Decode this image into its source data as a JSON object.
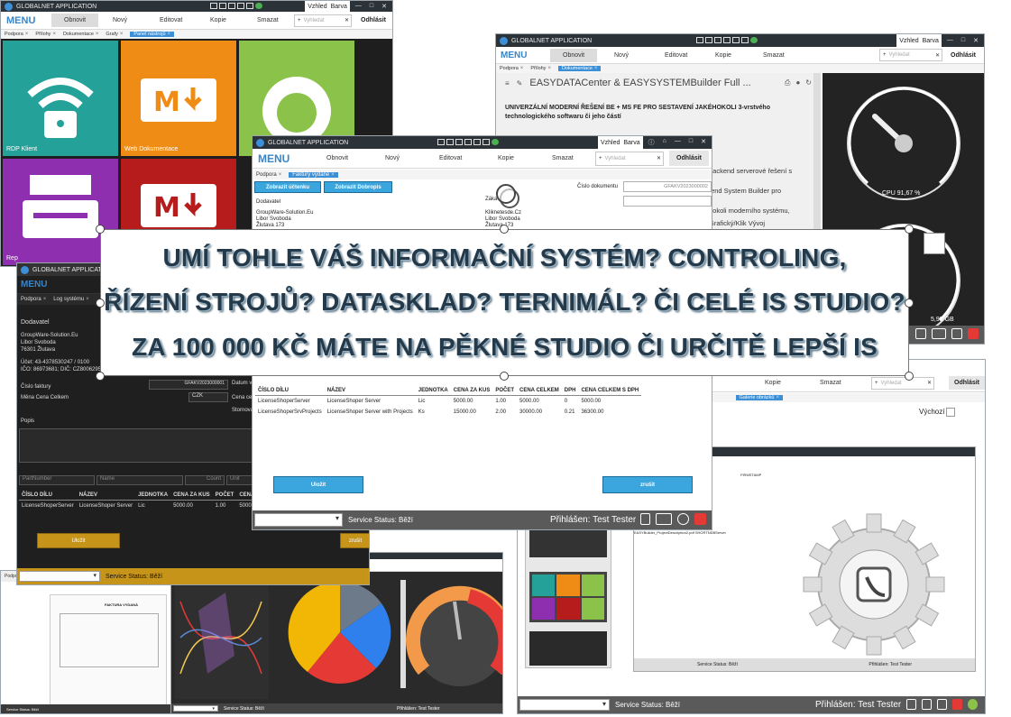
{
  "app_title": "GLOBALNET APPLICATION",
  "menu_label": "MENU",
  "menu_items": {
    "refresh": "Obnovit",
    "new": "Nový",
    "edit": "Editovat",
    "copy": "Kopie",
    "delete": "Smazat"
  },
  "search_placeholder": "Vyhledat",
  "logout": "Odhlásit",
  "view_label": "Vzhled",
  "color_label": "Barva",
  "win1": {
    "tabs": [
      "Podpora",
      "Přílohy",
      "Dokumentace",
      "Grafy",
      "Panel nástrojů"
    ],
    "tiles": [
      "RDP Klient",
      "Web Dokumentace"
    ],
    "tile_partial": "Rep"
  },
  "win2": {
    "tabs": [
      "Podpora",
      "Přílohy",
      "Dokumentace"
    ],
    "doc_title": "EASYDATACenter & EASYSYSTEMBuilder Full ...",
    "doc_heading": "UNIVERZÁLNÍ MODERNÍ ŘEŠENÍ BE + MS FE PRO SESTAVENÍ JAKÉHOKOLI 3-vrstvého technologického softwaru či jeho částí",
    "doc_lines": [
      "backend serverové řešení s",
      "tend System Builder pro",
      "hokoli moderního systému,",
      "Grafický/Klik Vývoj"
    ],
    "cpu_label": "CPU 91,67 %",
    "mem_label": "5,95 GB"
  },
  "win3": {
    "tabs": [
      "Podpora",
      "Faktury vydané"
    ],
    "btn_invoice": "Zobrazit účtenku",
    "btn_delivery": "Zobrazit Dobropis",
    "doc_number_label": "Číslo dokumentu",
    "doc_number": "GFAKV2023000002",
    "supplier_label": "Dodavatel",
    "supplier_lines": [
      "GroupWare-Solution.Eu",
      "Libor Svoboda",
      "Žlutava 173"
    ],
    "customer_label": "Záka",
    "customer_lines": [
      "Kliknetesde.Cz",
      "Libor Svoboda",
      "Žlutava 173"
    ],
    "columns": [
      "ČÍSLO DÍLU",
      "NÁZEV",
      "JEDNOTKA",
      "CENA ZA KUS",
      "POČET",
      "CENA CELKEM",
      "DPH",
      "CENA CELKEM S DPH"
    ],
    "rows": [
      [
        "LicenseShoperServer",
        "LicenseShoper Server",
        "Lic",
        "5000.00",
        "1.00",
        "5000.00",
        "0",
        "5000.00"
      ],
      [
        "LicenseShoperSrvProjects",
        "LicenseShoper Server with Projects",
        "Ks",
        "15000.00",
        "2.00",
        "30000.00",
        "0.21",
        "36300.00"
      ]
    ],
    "save": "Uložit",
    "cancel": "zrušit",
    "service_status": "Service Status: Běží",
    "signed_in": "Přihlášen: Test Tester"
  },
  "win4": {
    "tabs": [
      "Podpora",
      "Log systému"
    ],
    "supplier_label": "Dodavatel",
    "supplier_lines": [
      "GroupWare-Solution.Eu",
      "Libor Svoboda",
      "76301 Žlutava"
    ],
    "account": "Účet: 43-4378530247 / 0100",
    "ico": "IČO: 86973681; DIČ: CZ8006295135",
    "invoice_no_label": "Číslo faktury",
    "invoice_no": "GFAKV2023000001",
    "date_label": "Datum vy",
    "currency_label": "Měna Cena Celkem",
    "currency": "CZK",
    "total_label": "Cena cel",
    "storno_label": "Stornová",
    "note_label": "Popis",
    "filter_part": "PartNumber",
    "filter_name": "Name",
    "filter_count": "Count",
    "filter_unit": "Unit",
    "columns": [
      "ČÍSLO DÍLU",
      "NÁZEV",
      "JEDNOTKA",
      "CENA ZA KUS",
      "POČET",
      "CENA CELKEM"
    ],
    "row": [
      "LicenseShoperServer",
      "LicenseShoper Server",
      "Lic",
      "5000.00",
      "1.00",
      "5000.00"
    ],
    "save": "Uložit",
    "cancel": "zrušit",
    "service_status": "Service Status: Běží"
  },
  "win5": {
    "tabs": [
      "Podpora",
      "Přílohy",
      "Dokumentace",
      "Galerie obrázků"
    ],
    "default_label": "Výchozí",
    "service_status": "Service Status: Běží",
    "signed_in": "Přihlášen: Test Tester",
    "inner_status": "Service Status: Běží",
    "inner_signed": "Přihlášen: Test Tester",
    "inner_col": "FIRMSTAMP",
    "inner_row": "EASYBuilder_ProjectDescription2.pdf  SHORTNDBServer"
  },
  "win6": {
    "service_status": "Service Status: Běží",
    "signed_in": "Přihlášen: Test Tester",
    "invoice_title": "FAKTURA VYDANÁ"
  },
  "banner": {
    "line1": "UMÍ TOHLE VÁŠ INFORMAČNÍ SYSTÉM? CONTROLING,",
    "line2": "ŘÍZENÍ STROJŮ? DATASKLAD? TERNIMÁL? ČI CELÉ IS STUDIO?",
    "line3": "ZA 100 000 KČ MÁTE NA PĚKNÉ STUDIO ČI URČITĚ LEPŠÍ IS"
  },
  "colors": {
    "accent": "#3a8fd6",
    "titlebar": "#2b3238",
    "status": "#5a5a5a",
    "gold": "#c7941a",
    "banner_text": "#243a4a"
  }
}
